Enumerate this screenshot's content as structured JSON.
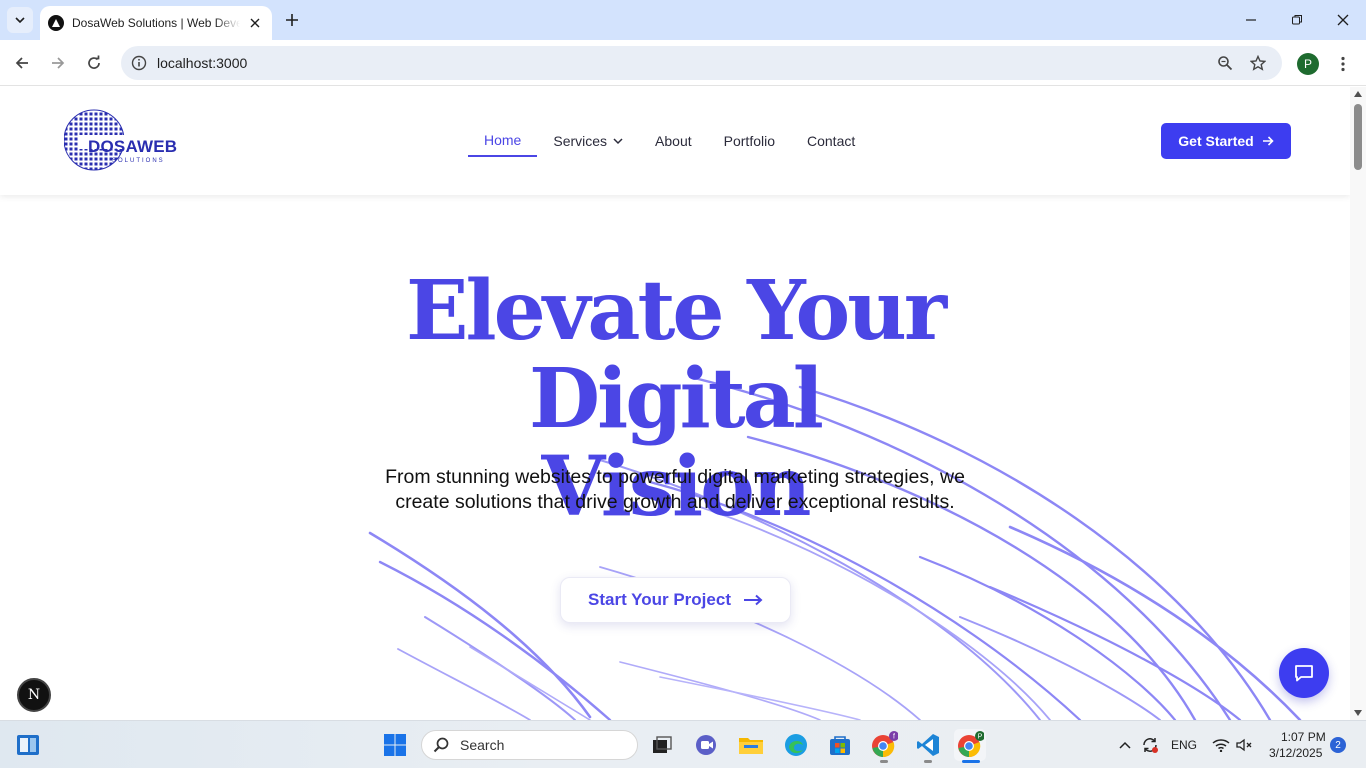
{
  "browser": {
    "tab_title": "DosaWeb Solutions | Web Development",
    "url": "localhost:3000",
    "profile_initial": "P"
  },
  "site": {
    "logo_text": "DOSAWEB",
    "logo_subtext": "SOLUTIONS",
    "nav": {
      "home": "Home",
      "services": "Services",
      "about": "About",
      "portfolio": "Portfolio",
      "contact": "Contact"
    },
    "cta_label": "Get Started",
    "hero_title_line1": "Elevate Your Digital",
    "hero_title_line2": "Vision",
    "hero_subtitle": "From stunning websites to powerful digital marketing strategies, we create solutions that drive growth and deliver exceptional results.",
    "hero_button": "Start Your Project",
    "next_badge": "N"
  },
  "taskbar": {
    "search_placeholder": "Search",
    "language": "ENG",
    "time": "1:07 PM",
    "date": "3/12/2025",
    "notification_count": "2",
    "pinned_icons": [
      "start-icon",
      "file-explorer-icon",
      "task-view-icon",
      "teams-icon",
      "folder-icon",
      "edge-icon",
      "store-icon",
      "chrome-icon",
      "vscode-icon",
      "chrome-profile-icon"
    ]
  },
  "colors": {
    "accent": "#4b46e5",
    "button": "#3d3df0",
    "tabbar": "#d3e3fd"
  }
}
